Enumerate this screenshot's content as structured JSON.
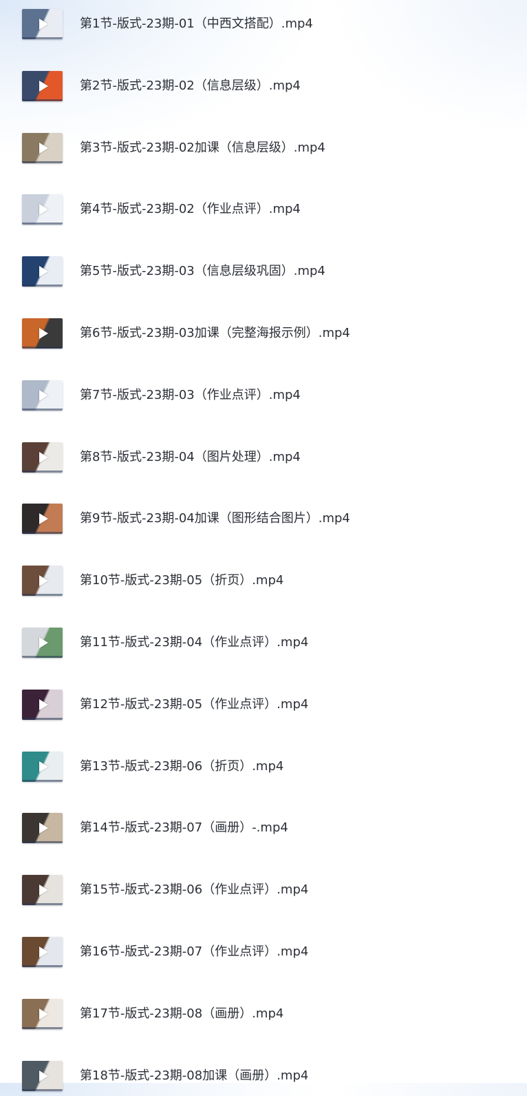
{
  "files": [
    {
      "name": "第1节-版式-23期-01（中西文搭配）.mp4",
      "thumb": {
        "bg": "#5d7290",
        "accent": "#e9edf3"
      }
    },
    {
      "name": "第2节-版式-23期-02（信息层级）.mp4",
      "thumb": {
        "bg": "#3a4a6a",
        "accent": "#e3582b"
      }
    },
    {
      "name": "第3节-版式-23期-02加课（信息层级）.mp4",
      "thumb": {
        "bg": "#8b7a62",
        "accent": "#d8d1c4"
      }
    },
    {
      "name": "第4节-版式-23期-02（作业点评）.mp4",
      "thumb": {
        "bg": "#c9d0db",
        "accent": "#eef1f5"
      }
    },
    {
      "name": "第5节-版式-23期-03（信息层级巩固）.mp4",
      "thumb": {
        "bg": "#23426f",
        "accent": "#e8edf4"
      }
    },
    {
      "name": "第6节-版式-23期-03加课（完整海报示例）.mp4",
      "thumb": {
        "bg": "#c9662a",
        "accent": "#3a3a3a"
      }
    },
    {
      "name": "第7节-版式-23期-03（作业点评）.mp4",
      "thumb": {
        "bg": "#aeb9c9",
        "accent": "#eef1f5"
      }
    },
    {
      "name": "第8节-版式-23期-04（图片处理）.mp4",
      "thumb": {
        "bg": "#5a4036",
        "accent": "#eceae6"
      }
    },
    {
      "name": "第9节-版式-23期-04加课（图形结合图片）.mp4",
      "thumb": {
        "bg": "#2f2a2a",
        "accent": "#c27b52"
      }
    },
    {
      "name": "第10节-版式-23期-05（折页）.mp4",
      "thumb": {
        "bg": "#6d4d3b",
        "accent": "#e7eaee"
      }
    },
    {
      "name": "第11节-版式-23期-04（作业点评）.mp4",
      "thumb": {
        "bg": "#d4d7db",
        "accent": "#6a9a6e"
      }
    },
    {
      "name": "第12节-版式-23期-05（作业点评）.mp4",
      "thumb": {
        "bg": "#3b2238",
        "accent": "#d9cfd6"
      }
    },
    {
      "name": "第13节-版式-23期-06（折页）.mp4",
      "thumb": {
        "bg": "#2f8c8a",
        "accent": "#e9eef0"
      }
    },
    {
      "name": "第14节-版式-23期-07（画册）-.mp4",
      "thumb": {
        "bg": "#3c3632",
        "accent": "#c7b7a2"
      }
    },
    {
      "name": "第15节-版式-23期-06（作业点评）.mp4",
      "thumb": {
        "bg": "#4a3a33",
        "accent": "#e6e3df"
      }
    },
    {
      "name": "第16节-版式-23期-07（作业点评）.mp4",
      "thumb": {
        "bg": "#6b4a32",
        "accent": "#e4e8ee"
      }
    },
    {
      "name": "第17节-版式-23期-08（画册）.mp4",
      "thumb": {
        "bg": "#8a6f55",
        "accent": "#ede8e1"
      }
    },
    {
      "name": "第18节-版式-23期-08加课（画册）.mp4",
      "thumb": {
        "bg": "#4f5a63",
        "accent": "#e6e3de"
      }
    }
  ],
  "icons": {
    "thumbnail_overlay": "play-icon"
  }
}
